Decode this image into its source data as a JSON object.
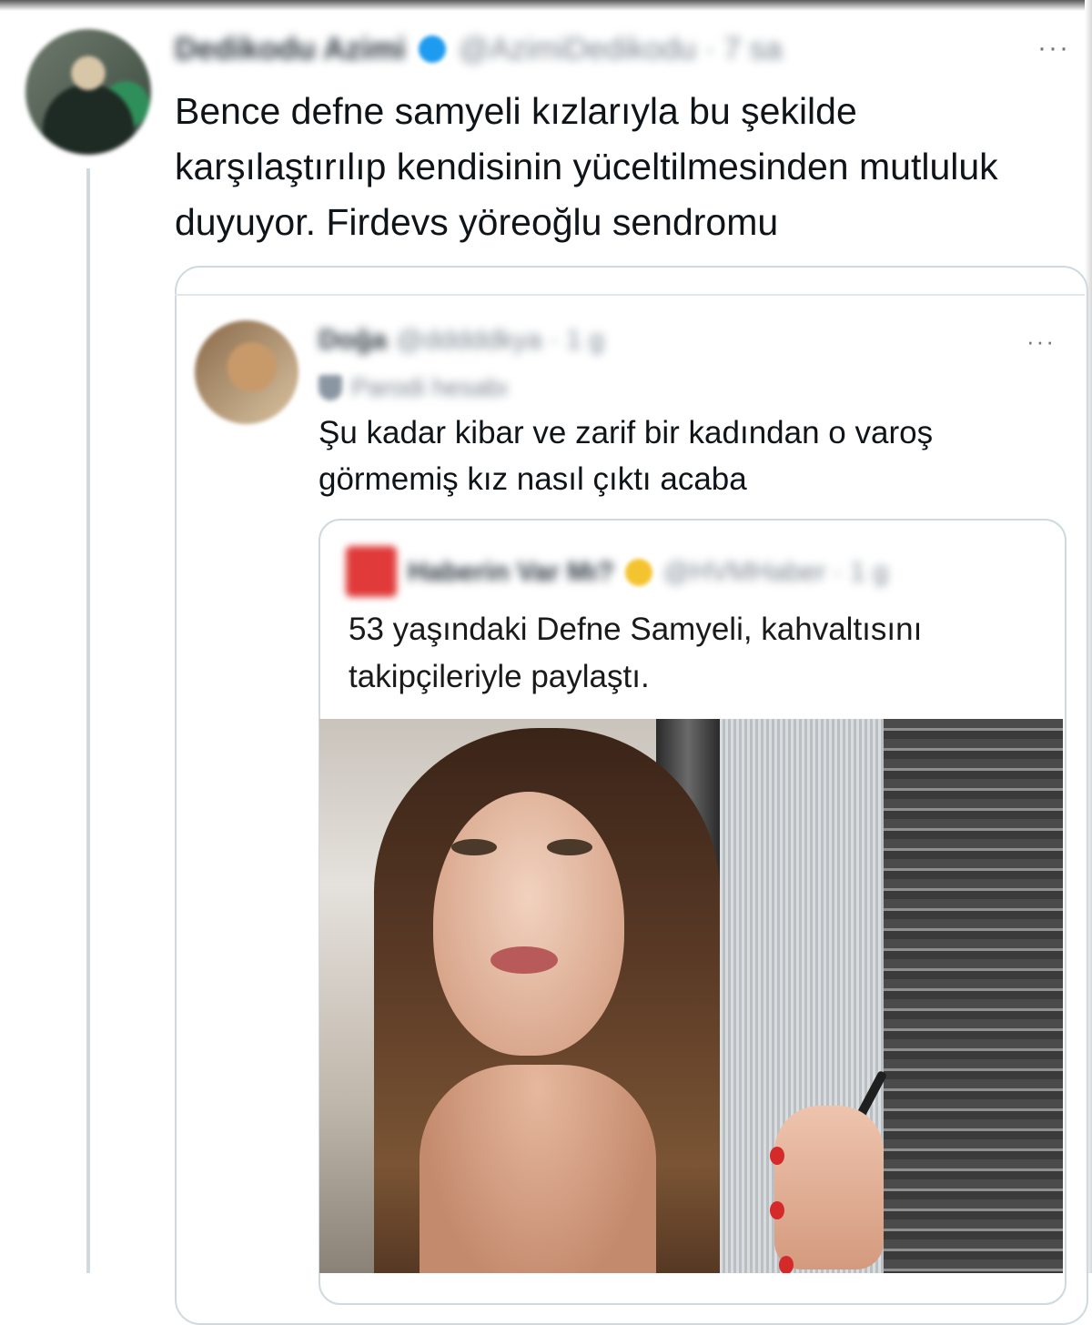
{
  "main_tweet": {
    "author_name": "Dedikodu Azimi",
    "handle_time": "@AzimiDedikodu · 7 sa",
    "more_label": "···",
    "text": "Bence defne samyeli kızlarıyla bu şekilde karşılaştırılıp kendisinin yüceltilmesinden mutluluk duyuyor. Firdevs yöreoğlu sendromu"
  },
  "quote1": {
    "author_name": "Doğa",
    "handle_time": "@dddddkya · 1 g",
    "parody_label": "Parodi hesabı",
    "more_label": "···",
    "text": "Şu kadar kibar ve zarif bir kadından o varoş görmemiş kız nasıl çıktı acaba"
  },
  "quote2": {
    "author_name": "Haberin Var Mı?",
    "handle_time": "@HVMHaber · 1 g",
    "text": "53 yaşındaki Defne Samyeli, kahvaltısını takipçileriyle paylaştı."
  },
  "colors": {
    "verified_blue": "#1d9bf0",
    "gold_badge": "#f4c430",
    "border": "#cfd9de",
    "text": "#0f1419"
  }
}
